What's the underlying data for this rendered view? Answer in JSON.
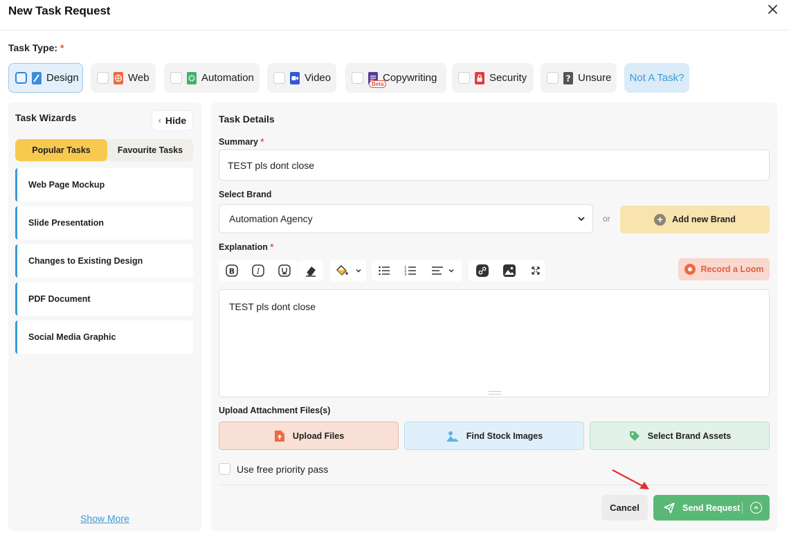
{
  "header": {
    "title": "New Task Request",
    "close_icon": "close-icon"
  },
  "task_type": {
    "label": "Task Type:",
    "required_mark": "*",
    "options": [
      {
        "label": "Design",
        "icon": "pencil-ruler-icon",
        "selected": true
      },
      {
        "label": "Web",
        "icon": "globe-icon",
        "selected": false
      },
      {
        "label": "Automation",
        "icon": "gear-icon",
        "selected": false
      },
      {
        "label": "Video",
        "icon": "video-camera-icon",
        "selected": false
      },
      {
        "label": "Copywriting",
        "icon": "copywriting-icon",
        "badge": "Beta",
        "selected": false
      },
      {
        "label": "Security",
        "icon": "lock-icon",
        "selected": false
      },
      {
        "label": "Unsure",
        "icon": "question-icon",
        "selected": false
      }
    ],
    "not_a_task": "Not A Task?"
  },
  "wizards": {
    "title": "Task Wizards",
    "hide_label": "Hide",
    "tabs": {
      "popular": "Popular Tasks",
      "favourite": "Favourite Tasks"
    },
    "items": [
      "Web Page Mockup",
      "Slide Presentation",
      "Changes to Existing Design",
      "PDF Document",
      "Social Media Graphic"
    ],
    "show_more": "Show More"
  },
  "details": {
    "title": "Task Details",
    "summary_label": "Summary",
    "summary_value": "TEST pls dont close",
    "brand_label": "Select Brand",
    "brand_value": "Automation Agency",
    "or": "or",
    "add_brand": "Add new Brand",
    "explanation_label": "Explanation",
    "explanation_value": "TEST pls dont close",
    "record_loom": "Record a Loom",
    "upload_label": "Upload Attachment Files(s)",
    "upload_files": "Upload Files",
    "stock_images": "Find Stock Images",
    "brand_assets": "Select Brand Assets",
    "priority_label": "Use free priority pass",
    "cancel": "Cancel",
    "send": "Send Request"
  },
  "colors": {
    "accent": "#3a9ad9",
    "popular_tab": "#f8c94f",
    "send": "#5ab877",
    "loom": "#e0613f",
    "required": "#e5533d"
  }
}
